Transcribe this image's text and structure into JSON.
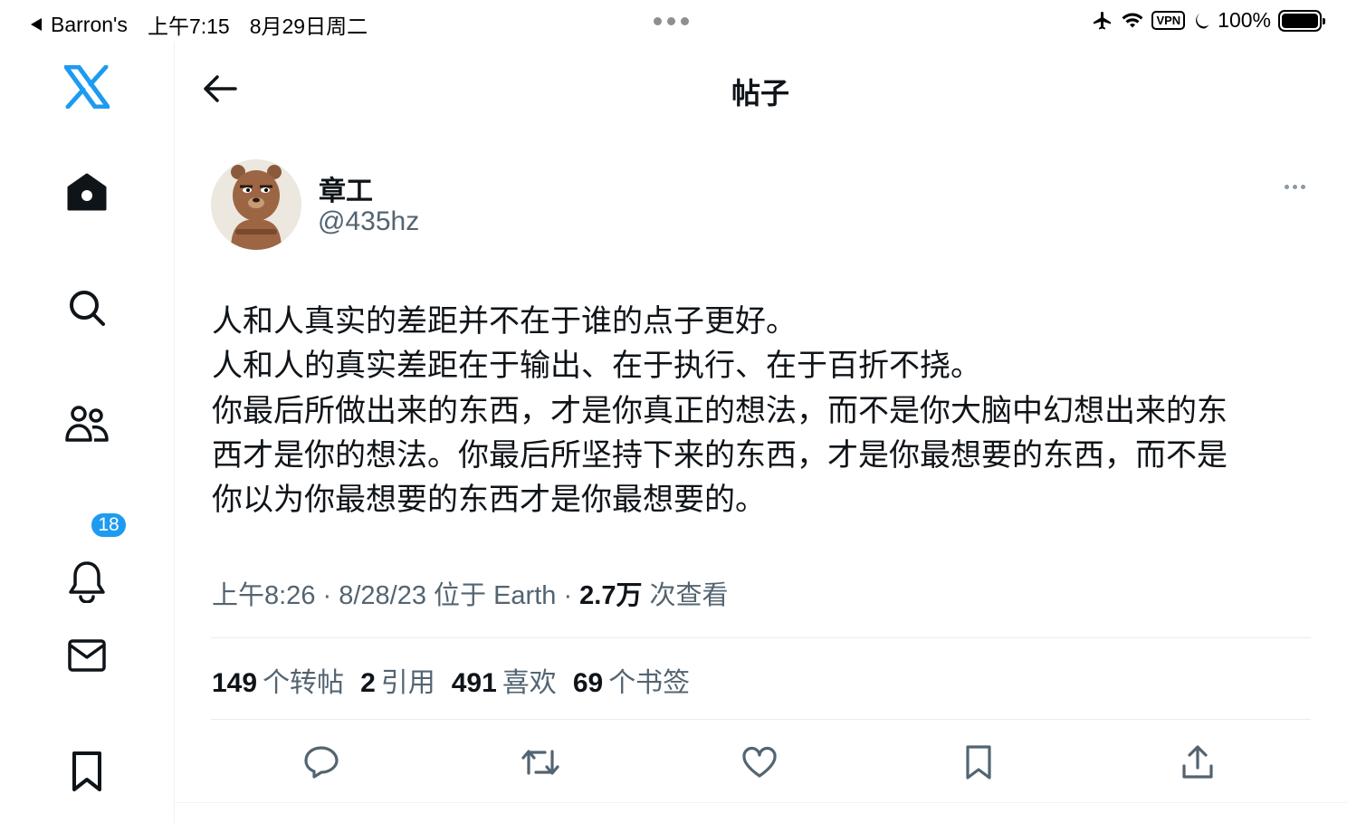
{
  "status_bar": {
    "back_app": "Barron's",
    "time": "上午7:15",
    "date": "8月29日周二",
    "vpn": "VPN",
    "battery": "100%"
  },
  "sidebar": {
    "items": [
      {
        "name": "home",
        "icon": "home-icon"
      },
      {
        "name": "search",
        "icon": "search-icon"
      },
      {
        "name": "communities",
        "icon": "people-icon"
      },
      {
        "name": "notifications",
        "icon": "bell-icon",
        "badge": "18"
      },
      {
        "name": "messages",
        "icon": "mail-icon"
      },
      {
        "name": "bookmarks",
        "icon": "bookmark-icon"
      }
    ],
    "logo": "x-logo-icon",
    "accent": "#1d9bf0"
  },
  "header": {
    "title": "帖子"
  },
  "post": {
    "author_name": "章工",
    "author_handle": "@435hz",
    "body_lines": [
      "人和人真实的差距并不在于谁的点子更好。",
      "人和人的真实差距在于输出、在于执行、在于百折不挠。",
      "你最后所做出来的东西，才是你真正的想法，而不是你大脑中幻想出来的东",
      "西才是你的想法。你最后所坚持下来的东西，才是你最想要的东西，而不是",
      "你以为你最想要的东西才是你最想要的。"
    ],
    "meta_time": "上午8:26 · 8/28/23 位于 Earth · ",
    "views_count": "2.7万",
    "views_label": " 次查看",
    "stats": {
      "reposts_count": "149",
      "reposts_label": "个转帖",
      "quotes_count": "2",
      "quotes_label": "引用",
      "likes_count": "491",
      "likes_label": "喜欢",
      "bookmarks_count": "69",
      "bookmarks_label": "个书签"
    }
  }
}
